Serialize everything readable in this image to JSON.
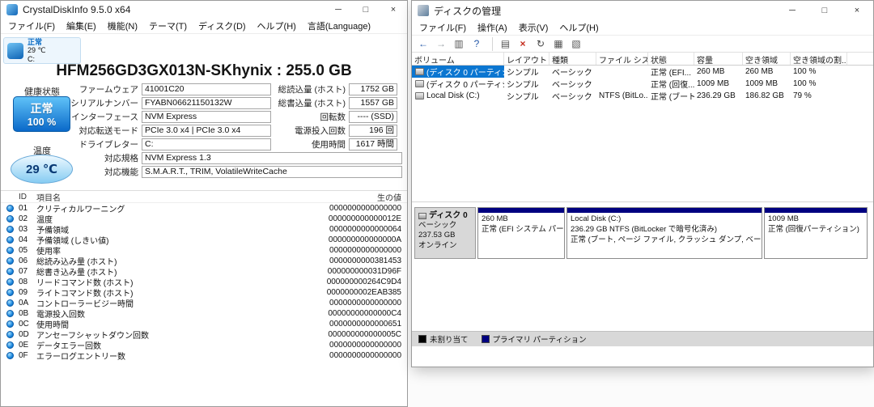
{
  "colors": {
    "selection": "#0b76d1",
    "partition_bar": "#000080",
    "health_top": "#5fc2f8",
    "health_bottom": "#0a69c9"
  },
  "cdi": {
    "title": "CrystalDiskInfo 9.5.0 x64",
    "controls": {
      "minimize": "─",
      "maximize": "□",
      "close": "×"
    },
    "menu": [
      "ファイル(F)",
      "編集(E)",
      "機能(N)",
      "テーマ(T)",
      "ディスク(D)",
      "ヘルプ(H)",
      "言語(Language)"
    ],
    "tile": {
      "status": "正常",
      "temp": "29 ℃",
      "drive": "C:"
    },
    "model": "HFM256GD3GX013N-SKhynix : 255.0 GB",
    "health": {
      "label": "健康状態",
      "status": "正常",
      "percent": "100 %"
    },
    "temperature": {
      "label": "温度",
      "value": "29 ℃"
    },
    "info_fields": [
      {
        "label": "ファームウェア",
        "value": "41001C20"
      },
      {
        "label": "シリアルナンバー",
        "value": "FYABN06621150132W"
      },
      {
        "label": "インターフェース",
        "value": "NVM Express"
      },
      {
        "label": "対応転送モード",
        "value": "PCIe 3.0 x4 | PCIe 3.0 x4"
      },
      {
        "label": "ドライブレター",
        "value": "C:"
      }
    ],
    "wide_fields": [
      {
        "label": "対応規格",
        "value": "NVM Express 1.3"
      },
      {
        "label": "対応機能",
        "value": "S.M.A.R.T., TRIM, VolatileWriteCache"
      }
    ],
    "stat_fields": [
      {
        "label": "総読込量 (ホスト)",
        "value": "1752 GB"
      },
      {
        "label": "総書込量 (ホスト)",
        "value": "1557 GB"
      },
      {
        "label": "回転数",
        "value": "---- (SSD)"
      },
      {
        "label": "電源投入回数",
        "value": "196 回"
      },
      {
        "label": "使用時間",
        "value": "1617 時間"
      }
    ],
    "smart": {
      "col_id": "ID",
      "col_name": "項目名",
      "col_raw": "生の値",
      "rows": [
        {
          "id": "01",
          "name": "クリティカルワーニング",
          "raw": "0000000000000000"
        },
        {
          "id": "02",
          "name": "温度",
          "raw": "000000000000012E"
        },
        {
          "id": "03",
          "name": "予備領域",
          "raw": "0000000000000064"
        },
        {
          "id": "04",
          "name": "予備領域 (しきい値)",
          "raw": "000000000000000A"
        },
        {
          "id": "05",
          "name": "使用率",
          "raw": "0000000000000000"
        },
        {
          "id": "06",
          "name": "総読み込み量 (ホスト)",
          "raw": "0000000000381453"
        },
        {
          "id": "07",
          "name": "総書き込み量 (ホスト)",
          "raw": "000000000031D96F"
        },
        {
          "id": "08",
          "name": "リードコマンド数 (ホスト)",
          "raw": "000000000264C9D4"
        },
        {
          "id": "09",
          "name": "ライトコマンド数 (ホスト)",
          "raw": "0000000002EAB385"
        },
        {
          "id": "0A",
          "name": "コントローラービジー時間",
          "raw": "0000000000000000"
        },
        {
          "id": "0B",
          "name": "電源投入回数",
          "raw": "00000000000000C4"
        },
        {
          "id": "0C",
          "name": "使用時間",
          "raw": "0000000000000651"
        },
        {
          "id": "0D",
          "name": "アンセーフシャットダウン回数",
          "raw": "000000000000005C"
        },
        {
          "id": "0E",
          "name": "データエラー回数",
          "raw": "0000000000000000"
        },
        {
          "id": "0F",
          "name": "エラーログエントリー数",
          "raw": "0000000000000000"
        }
      ]
    }
  },
  "dm": {
    "title": "ディスクの管理",
    "controls": {
      "minimize": "─",
      "maximize": "□",
      "close": "×"
    },
    "menu": [
      "ファイル(F)",
      "操作(A)",
      "表示(V)",
      "ヘルプ(H)"
    ],
    "toolbar": [
      {
        "icon_name": "back-icon",
        "glyph": "←",
        "color": "#2458a8"
      },
      {
        "icon_name": "forward-icon",
        "glyph": "→",
        "color": "#9aa0a6"
      },
      {
        "icon_name": "console-tree-icon",
        "glyph": "▥",
        "color": "#555555"
      },
      {
        "icon_name": "help-icon",
        "glyph": "?",
        "color": "#2458a8"
      },
      {
        "icon_name": "properties-icon",
        "glyph": "▤",
        "color": "#555555"
      },
      {
        "icon_name": "delete-volume-icon",
        "glyph": "×",
        "color": "#c42b1c"
      },
      {
        "icon_name": "refresh-icon",
        "glyph": "↻",
        "color": "#444444"
      },
      {
        "icon_name": "rescan-disks-icon",
        "glyph": "▦",
        "color": "#555555"
      },
      {
        "icon_name": "new-window-icon",
        "glyph": "▧",
        "color": "#555555"
      }
    ],
    "columns": [
      "ボリューム",
      "レイアウト",
      "種類",
      "ファイル システム",
      "状態",
      "容量",
      "空き領域",
      "空き領域の割..."
    ],
    "volumes": [
      {
        "name": "(ディスク 0 パーティシ...",
        "layout": "シンプル",
        "type": "ベーシック",
        "fs": "",
        "status": "正常 (EFI...",
        "capacity": "260 MB",
        "free": "260 MB",
        "pct": "100 %",
        "selected": true
      },
      {
        "name": "(ディスク 0 パーティシ...",
        "layout": "シンプル",
        "type": "ベーシック",
        "fs": "",
        "status": "正常 (回復...",
        "capacity": "1009 MB",
        "free": "1009 MB",
        "pct": "100 %"
      },
      {
        "name": "Local Disk (C:)",
        "layout": "シンプル",
        "type": "ベーシック",
        "fs": "NTFS (BitLo...",
        "status": "正常 (ブート...",
        "capacity": "236.29 GB",
        "free": "186.82 GB",
        "pct": "79 %"
      }
    ],
    "disk": {
      "name": "ディスク 0",
      "type": "ベーシック",
      "size": "237.53 GB",
      "status": "オンライン"
    },
    "partitions": [
      {
        "title": "",
        "size": "260 MB",
        "status": "正常 (EFI システム パーティシ"
      },
      {
        "title": "Local Disk (C:)",
        "size": "236.29 GB NTFS (BitLocker で暗号化済み)",
        "status": "正常 (ブート, ページ ファイル, クラッシュ ダンプ, ベーシック データ パーティ"
      },
      {
        "title": "",
        "size": "1009 MB",
        "status": "正常 (回復パーティション)"
      }
    ],
    "legend": [
      {
        "label": "未割り当て",
        "color": "#000000"
      },
      {
        "label": "プライマリ パーティション",
        "color": "#000080"
      }
    ]
  }
}
